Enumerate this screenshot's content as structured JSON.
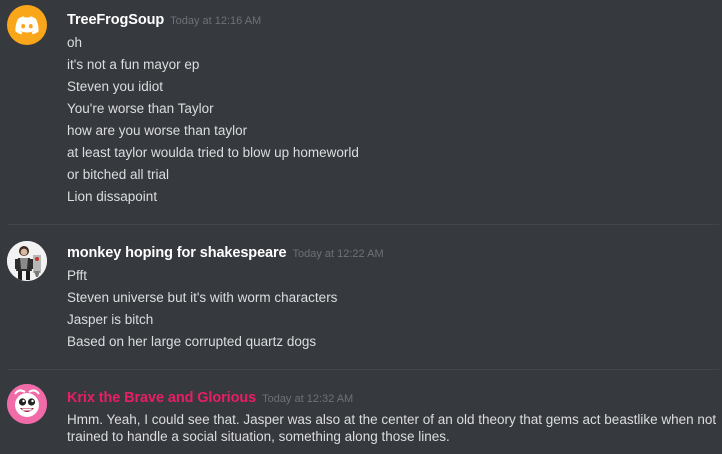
{
  "colors": {
    "background": "#36393e",
    "divider": "#42454a",
    "username_default": "#ffffff",
    "username_role": "#e91e63",
    "timestamp": "#6e7176",
    "message_text": "#dcddde"
  },
  "messages": [
    {
      "username": "TreeFrogSoup",
      "timestamp": "Today at 12:16 AM",
      "avatar_icon": "discord-logo-icon",
      "lines": [
        "oh",
        "it's not a fun mayor ep",
        "Steven you idiot",
        "You're worse than Taylor",
        "how are you worse than taylor",
        "at least taylor woulda tried to blow up homeworld",
        "or bitched all trial",
        "Lion dissapoint"
      ]
    },
    {
      "username": "monkey hoping for shakespeare",
      "timestamp": "Today at 12:22 AM",
      "avatar_icon": "character-portrait-icon",
      "lines": [
        "Pfft",
        "Steven universe but it's with worm characters",
        "Jasper is bitch",
        "Based on her large corrupted quartz dogs"
      ]
    },
    {
      "username": "Krix the Brave and Glorious",
      "timestamp": "Today at 12:32 AM",
      "avatar_icon": "pink-face-icon",
      "lines": [
        "Hmm. Yeah, I could see that. Jasper was also at the center of an old theory that gems act beastlike when not trained to handle a social situation, something along those lines."
      ]
    }
  ]
}
